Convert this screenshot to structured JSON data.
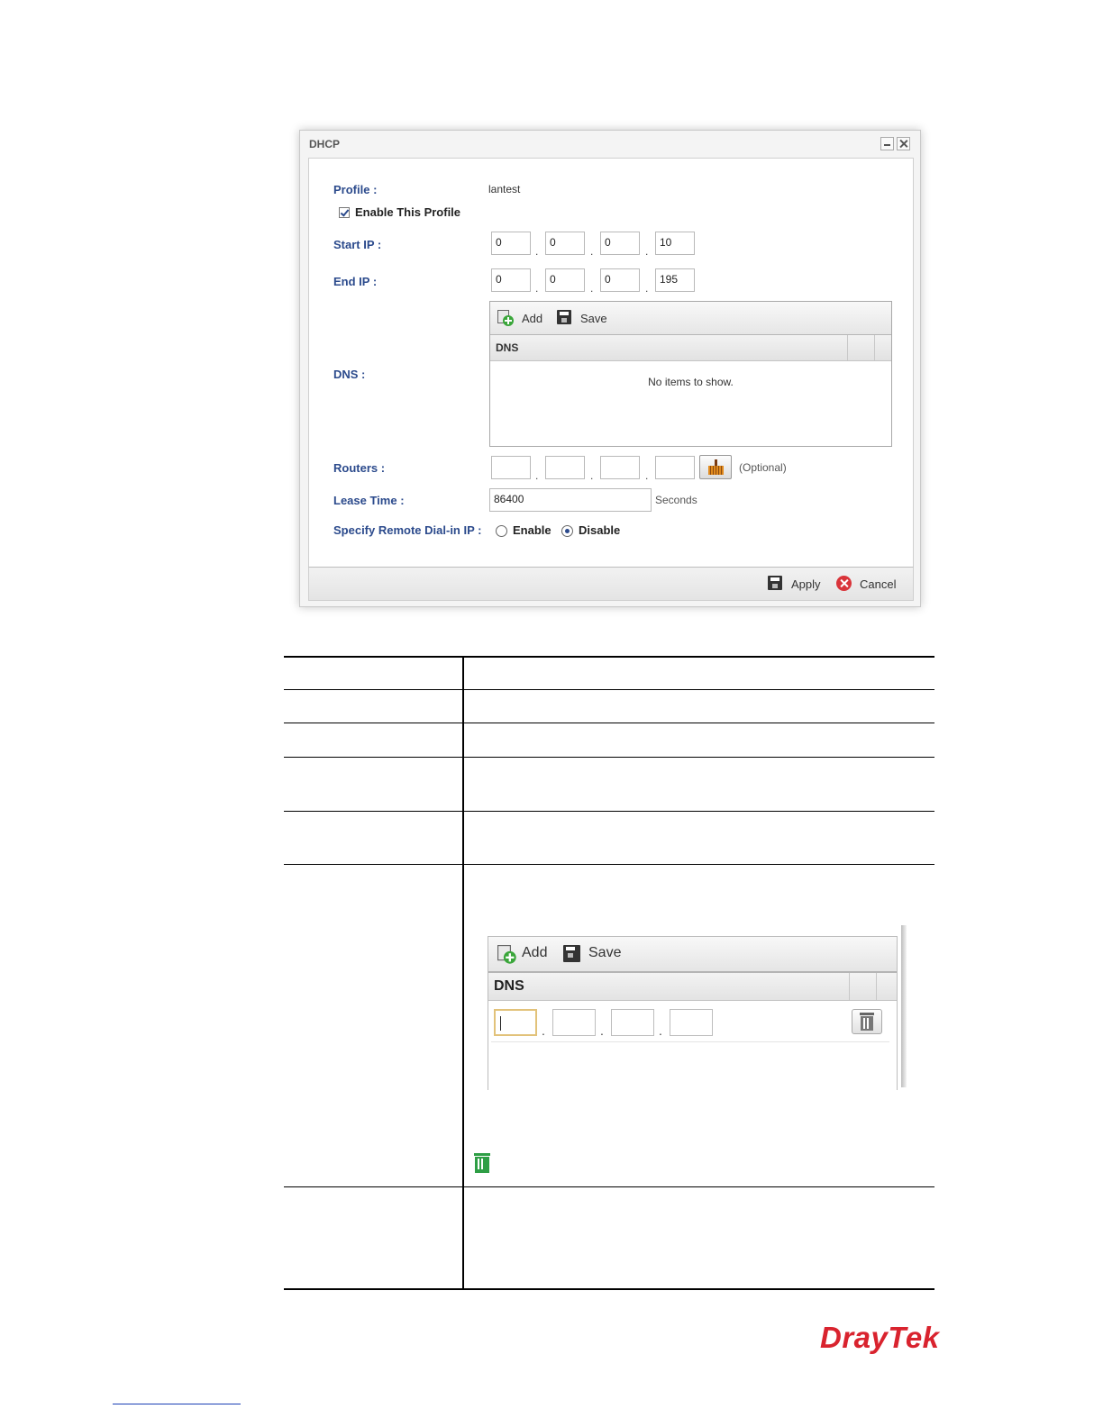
{
  "dialog": {
    "title": "DHCP",
    "profile_label": "Profile :",
    "profile_value": "lantest",
    "enable_profile_label": "Enable This Profile",
    "start_ip_label": "Start IP :",
    "start_ip": [
      "0",
      "0",
      "0",
      "10"
    ],
    "end_ip_label": "End IP :",
    "end_ip": [
      "0",
      "0",
      "0",
      "195"
    ],
    "dns_label": "DNS :",
    "dns_grid": {
      "add_label": "Add",
      "save_label": "Save",
      "column_header": "DNS",
      "empty_text": "No items to show."
    },
    "routers_label": "Routers :",
    "routers_optional": "(Optional)",
    "lease_time_label": "Lease Time :",
    "lease_time_value": "86400",
    "lease_time_unit": "Seconds",
    "remote_dialin_label": "Specify Remote Dial-in IP :",
    "radio_enable": "Enable",
    "radio_disable": "Disable",
    "apply_label": "Apply",
    "cancel_label": "Cancel"
  },
  "snippet": {
    "add_label": "Add",
    "save_label": "Save",
    "column_header": "DNS"
  },
  "brand": {
    "logo_text": "DrayTek",
    "color": "#d9232e"
  }
}
